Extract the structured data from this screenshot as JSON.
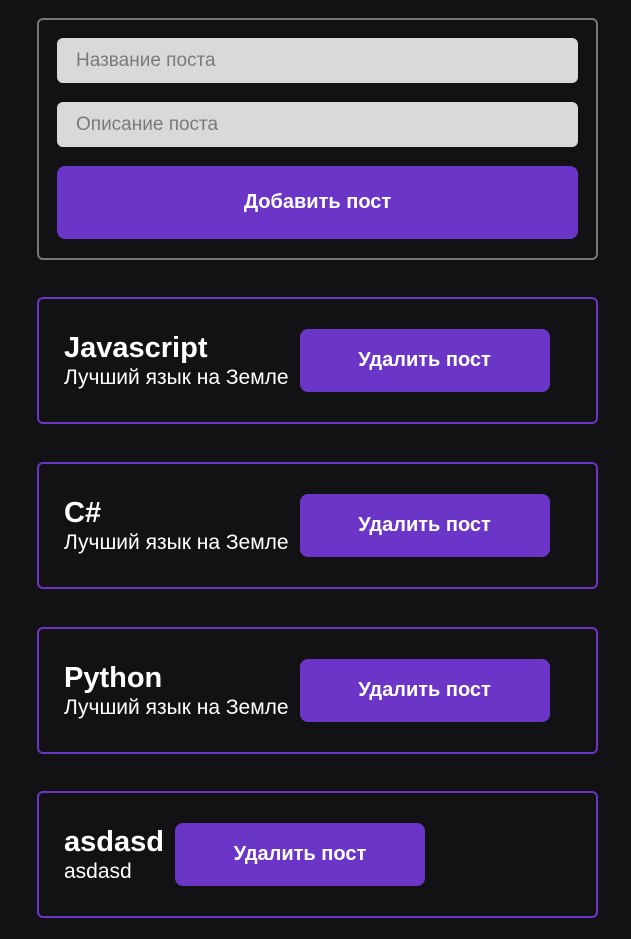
{
  "form": {
    "title_placeholder": "Название поста",
    "description_placeholder": "Описание поста",
    "add_label": "Добавить пост"
  },
  "posts": [
    {
      "title": "Javascript",
      "body": "Лучший язык на Земле",
      "delete_label": "Удалить пост"
    },
    {
      "title": "C#",
      "body": "Лучший язык на Земле",
      "delete_label": "Удалить пост"
    },
    {
      "title": "Python",
      "body": "Лучший язык на Земле",
      "delete_label": "Удалить пост"
    },
    {
      "title": "asdasd",
      "body": "asdasd",
      "delete_label": "Удалить пост"
    }
  ],
  "colors": {
    "background": "#121113",
    "accent": "#6b35c8",
    "form_border": "#77767c",
    "input_bg": "#d9d9d9"
  }
}
